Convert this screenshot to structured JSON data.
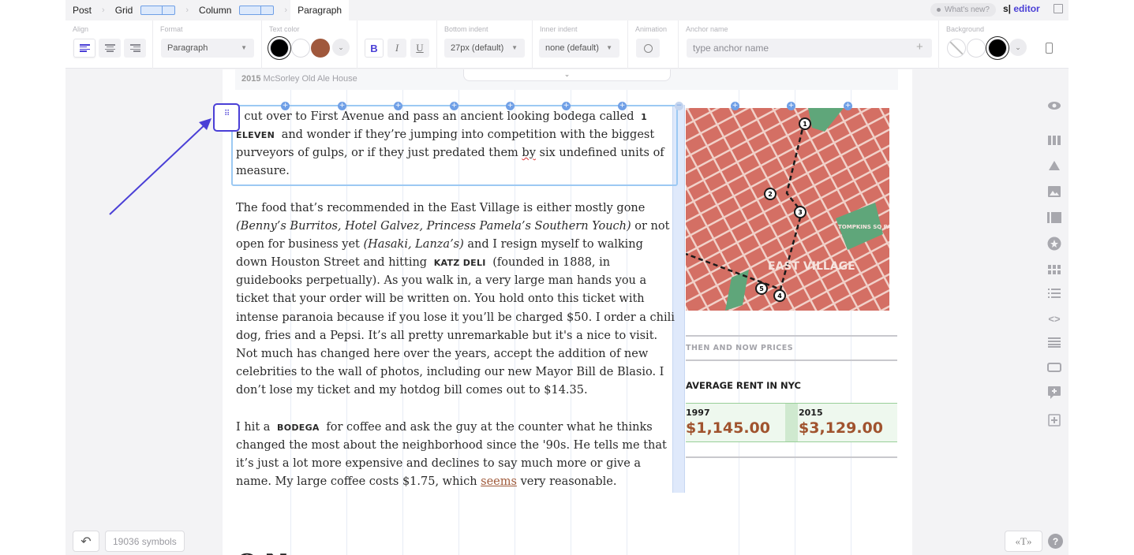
{
  "breadcrumb": [
    "Post",
    "Grid",
    "Column",
    "Paragraph"
  ],
  "header": {
    "whats_new": "What's new?",
    "brand_prefix": "s|",
    "brand_name": "editor"
  },
  "toolbar": {
    "align_label": "Align",
    "format_label": "Format",
    "format_value": "Paragraph",
    "text_color_label": "Text color",
    "text_colors": [
      "#000000",
      "#ffffff",
      "#a0583c"
    ],
    "bottom_indent_label": "Bottom indent",
    "bottom_indent_value": "27px (default)",
    "inner_indent_label": "Inner indent",
    "inner_indent_value": "none (default)",
    "animation_label": "Animation",
    "anchor_label": "Anchor name",
    "anchor_placeholder": "type anchor name",
    "background_label": "Background",
    "background_colors": [
      "none",
      "#ffffff",
      "#000000"
    ]
  },
  "previous_block_caption": {
    "year": "2015",
    "text": "McSorley Old Ale House"
  },
  "article": {
    "p1": {
      "a": "I cut over to First Avenue and pass an ancient looking bodega  called",
      "mark": "1 ELEVEN",
      "b": "and wonder if they’re jumping into competition with the biggest purveyors of gulps, or if they just predated them",
      "flagged": "by",
      "c": "six undefined units of measure."
    },
    "p2": {
      "a": "The food that’s recommended in the East Village is either mostly gone",
      "ital1": "(Benny’s Burritos, Hotel Galvez, Princess Pamela’s Southern Youch)",
      "b": "or not open for business yet",
      "ital2": "(Hasaki, Lanza’s)",
      "c": "and I resign myself to walking down Houston Street and hitting",
      "mark": "KATZ DELI",
      "d": "(founded in 1888, in guidebooks perpetually). As you walk in, a very large man hands you a ticket that your order will be written on. You hold onto this ticket with intense paranoia because if you lose it you’ll be charged $50. I order a chili dog, fries and a Pepsi. It’s all pretty unremarkable but it's a nice to visit. Not much has changed here over the years, accept the addition of new celebrities to the wall of photos, including our new Mayor Bill de Blasio. I don’t lose my ticket and my hotdog bill comes out to $14.35."
    },
    "p3": {
      "a": "I hit a",
      "mark": "BODEGA",
      "b": "for coffee and ask the guy at the counter what he thinks changed the most about the neighborhood since the '90s. He tells me that it’s just a lot more expensive and declines to say much more or give a name. My large coffee costs $1.75, which",
      "link": "seems",
      "c": "very reasonable."
    }
  },
  "map": {
    "label": "EAST VILLAGE",
    "park": "TOMPKINS SQ PARK",
    "markers": [
      "1",
      "2",
      "3",
      "4",
      "5"
    ]
  },
  "sidebar": {
    "kicker": "THEN AND NOW PRICES",
    "title": "AVERAGE RENT IN NYC",
    "rents": [
      {
        "year": "1997",
        "amount": "$1,145.00"
      },
      {
        "year": "2015",
        "amount": "$3,129.00"
      }
    ]
  },
  "footer": {
    "symbols": "19036 symbols",
    "type_button": "«T»",
    "help": "?"
  },
  "colors": {
    "accent": "#4a3fd6",
    "selection": "#9cc9f3",
    "rent_amount": "#a0532e",
    "map_base": "#d46f64"
  }
}
